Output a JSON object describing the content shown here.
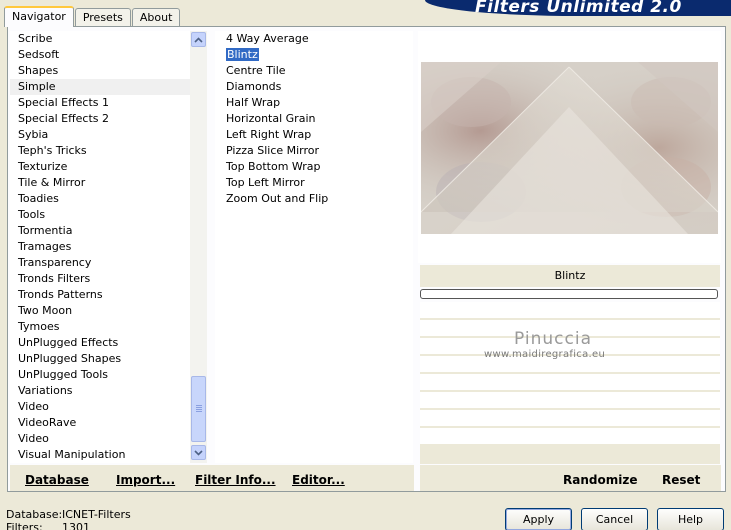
{
  "tabs": [
    {
      "label": "Navigator",
      "active": true
    },
    {
      "label": "Presets",
      "active": false
    },
    {
      "label": "About",
      "active": false
    }
  ],
  "banner": {
    "title": "Filters Unlimited 2.0",
    "color": "#0a2a6e"
  },
  "categories": {
    "items": [
      "Scribe",
      "Sedsoft",
      "Shapes",
      "Simple",
      "Special Effects 1",
      "Special Effects 2",
      "Sybia",
      "Teph's Tricks",
      "Texturize",
      "Tile & Mirror",
      "Toadies",
      "Tools",
      "Tormentia",
      "Tramages",
      "Transparency",
      "Tronds Filters",
      "Tronds Patterns",
      "Two Moon",
      "Tymoes",
      "UnPlugged Effects",
      "UnPlugged Shapes",
      "UnPlugged Tools",
      "Variations",
      "Video",
      "VideoRave",
      "Video",
      "Visual Manipulation"
    ],
    "selected": "Simple"
  },
  "filters": {
    "items": [
      "4 Way Average",
      "Blintz",
      "Centre Tile",
      "Diamonds",
      "Half Wrap",
      "Horizontal Grain",
      "Left Right Wrap",
      "Pizza Slice Mirror",
      "Top Bottom Wrap",
      "Top Left Mirror",
      "Zoom Out and Flip"
    ],
    "selected": "Blintz"
  },
  "preview": {
    "filter_name": "Blintz"
  },
  "watermark": {
    "name": "Pinuccia",
    "url": "www.maidiregrafica.eu"
  },
  "bottom_links": {
    "database": "Database",
    "import": "Import...",
    "filter_info": "Filter Info...",
    "editor": "Editor...",
    "randomize": "Randomize",
    "reset": "Reset"
  },
  "status": {
    "database_label": "Database:",
    "database_value": "ICNET-Filters",
    "filters_label": "Filters:",
    "filters_value": "1301"
  },
  "buttons": {
    "apply": "Apply",
    "cancel": "Cancel",
    "help": "Help"
  },
  "colors": {
    "selection": "#316ac5",
    "tab_highlight": "#ffc83c",
    "background": "#ece9d8"
  }
}
